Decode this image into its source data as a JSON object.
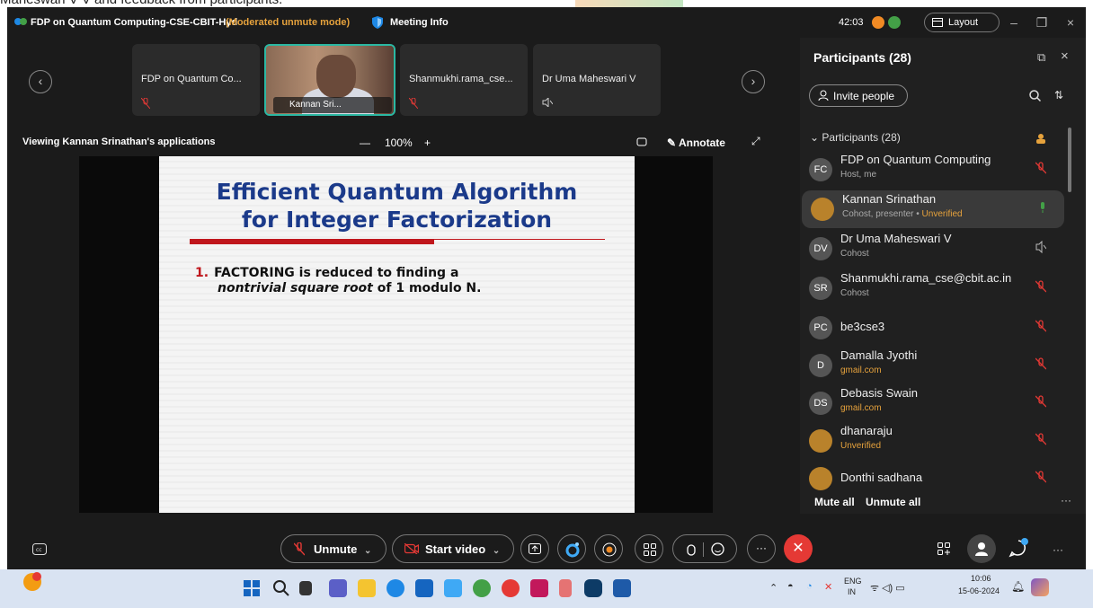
{
  "caption": "Maheswari V V and feedback from participants.",
  "titlebar": {
    "title": "FDP on Quantum Computing-CSE-CBIT-Hyd",
    "mode": "(Moderated unmute mode)",
    "meeting_info": "Meeting Info",
    "timer": "42:03",
    "layout_label": "Layout"
  },
  "thumbnails": [
    {
      "name": "FDP on Quantum Co..."
    },
    {
      "name": "Kannan Sri..."
    },
    {
      "name": "Shanmukhi.rama_cse..."
    },
    {
      "name": "Dr Uma Maheswari V"
    }
  ],
  "share": {
    "viewing": "Viewing Kannan Srinathan's applications",
    "zoom": "100%",
    "annotate": "Annotate"
  },
  "slide": {
    "title_line1": "Efficient Quantum Algorithm",
    "title_line2": "for Integer Factorization",
    "item_number": "1.",
    "item_bold": "FACTORING",
    "item_text1": "is reduced to finding a",
    "item_italic": "nontrivial square root",
    "item_text2": "of 1 modulo N."
  },
  "panel": {
    "title": "Participants (28)",
    "invite": "Invite people",
    "section": "Participants (28)",
    "mute_all": "Mute all",
    "unmute_all": "Unmute all",
    "participants": [
      {
        "initials": "FC",
        "name": "FDP on Quantum Computing",
        "sub": "Host, me",
        "warn": ""
      },
      {
        "initials": "",
        "name": "Kannan Srinathan",
        "sub": "Cohost, presenter • ",
        "warn": "Unverified"
      },
      {
        "initials": "DV",
        "name": "Dr Uma Maheswari V",
        "sub": "Cohost",
        "warn": ""
      },
      {
        "initials": "SR",
        "name": "Shanmukhi.rama_cse@cbit.ac.in",
        "sub": "Cohost",
        "warn": ""
      },
      {
        "initials": "PC",
        "name": "be3cse3",
        "sub": "",
        "warn": ""
      },
      {
        "initials": "D",
        "name": "Damalla Jyothi",
        "sub": "",
        "warn": "gmail.com"
      },
      {
        "initials": "DS",
        "name": "Debasis Swain",
        "sub": "",
        "warn": "gmail.com"
      },
      {
        "initials": "",
        "name": "dhanaraju",
        "sub": "",
        "warn": "Unverified"
      },
      {
        "initials": "",
        "name": "Donthi sadhana",
        "sub": "",
        "warn": ""
      }
    ]
  },
  "controls": {
    "unmute": "Unmute",
    "start_video": "Start video"
  },
  "taskbar": {
    "lang1": "ENG",
    "lang2": "IN",
    "time": "10:06",
    "date": "15-06-2024"
  },
  "colors": {
    "accent_teal": "#2bb8a3",
    "mute_red": "#e53935",
    "warning": "#e6a23c",
    "slide_title": "#1b3a8a"
  }
}
